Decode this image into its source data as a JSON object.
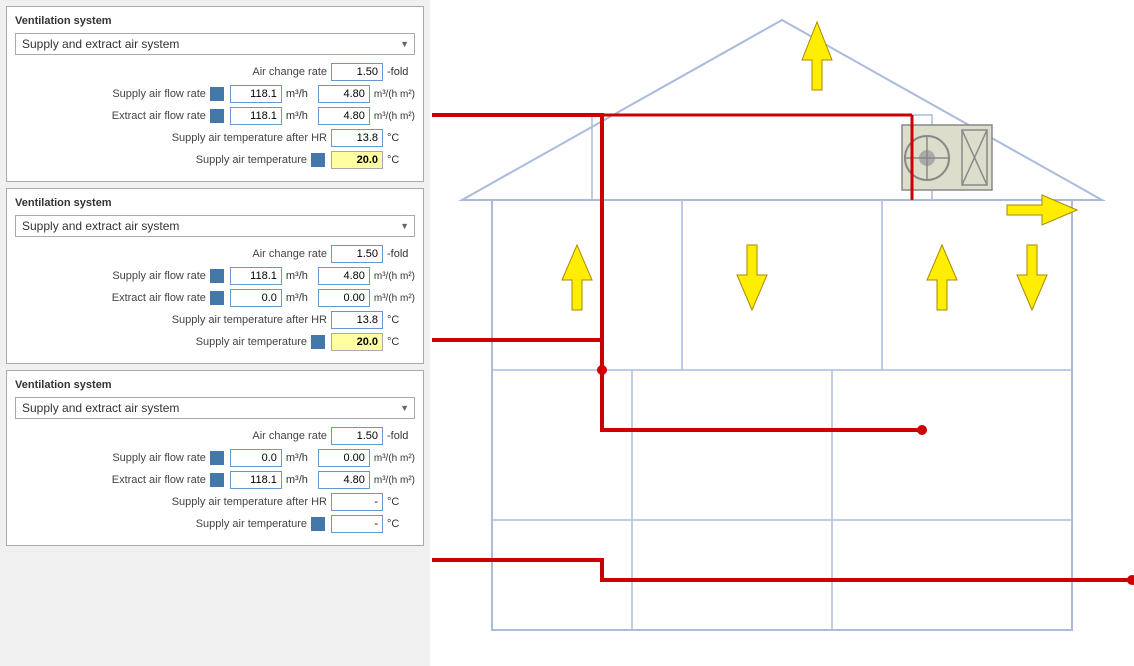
{
  "panels": [
    {
      "id": 1,
      "section_title": "Ventilation system",
      "dropdown_value": "Supply and extract air system",
      "rows": [
        {
          "label": "Air change rate",
          "value1": "1.50",
          "unit1": "-fold",
          "value2": null,
          "unit2": null,
          "has_icon": false,
          "bold": false
        },
        {
          "label": "Supply air flow rate",
          "value1": "118.1",
          "unit1": "m³/h",
          "value2": "4.80",
          "unit2": "m³/(h m²)",
          "has_icon": true,
          "bold": false
        },
        {
          "label": "Extract air flow rate",
          "value1": "118.1",
          "unit1": "m³/h",
          "value2": "4.80",
          "unit2": "m³/(h m²)",
          "has_icon": true,
          "bold": false
        },
        {
          "label": "Supply air temperature after HR",
          "value1": "13.8",
          "unit1": "°C",
          "value2": null,
          "unit2": null,
          "has_icon": false,
          "bold": false
        },
        {
          "label": "Supply air temperature",
          "value1": "20.0",
          "unit1": "°C",
          "value2": null,
          "unit2": null,
          "has_icon": true,
          "bold": true
        }
      ]
    },
    {
      "id": 2,
      "section_title": "Ventilation system",
      "dropdown_value": "Supply and extract air system",
      "rows": [
        {
          "label": "Air change rate",
          "value1": "1.50",
          "unit1": "-fold",
          "value2": null,
          "unit2": null,
          "has_icon": false,
          "bold": false
        },
        {
          "label": "Supply air flow rate",
          "value1": "118.1",
          "unit1": "m³/h",
          "value2": "4.80",
          "unit2": "m³/(h m²)",
          "has_icon": true,
          "bold": false
        },
        {
          "label": "Extract air flow rate",
          "value1": "0.0",
          "unit1": "m³/h",
          "value2": "0.00",
          "unit2": "m³/(h m²)",
          "has_icon": true,
          "bold": false
        },
        {
          "label": "Supply air temperature after HR",
          "value1": "13.8",
          "unit1": "°C",
          "value2": null,
          "unit2": null,
          "has_icon": false,
          "bold": false
        },
        {
          "label": "Supply air temperature",
          "value1": "20.0",
          "unit1": "°C",
          "value2": null,
          "unit2": null,
          "has_icon": true,
          "bold": true
        }
      ]
    },
    {
      "id": 3,
      "section_title": "Ventilation system",
      "dropdown_value": "Supply and extract air system",
      "rows": [
        {
          "label": "Air change rate",
          "value1": "1.50",
          "unit1": "-fold",
          "value2": null,
          "unit2": null,
          "has_icon": false,
          "bold": false
        },
        {
          "label": "Supply air flow rate",
          "value1": "0.0",
          "unit1": "m³/h",
          "value2": "0.00",
          "unit2": "m³/(h m²)",
          "has_icon": true,
          "bold": false
        },
        {
          "label": "Extract air flow rate",
          "value1": "118.1",
          "unit1": "m³/h",
          "value2": "4.80",
          "unit2": "m³/(h m²)",
          "has_icon": true,
          "bold": false
        },
        {
          "label": "Supply air temperature after HR",
          "value1": "-",
          "unit1": "°C",
          "value2": null,
          "unit2": null,
          "has_icon": false,
          "bold": false
        },
        {
          "label": "Supply air temperature",
          "value1": "-",
          "unit1": "°C",
          "value2": null,
          "unit2": null,
          "has_icon": true,
          "bold": false
        }
      ]
    }
  ]
}
